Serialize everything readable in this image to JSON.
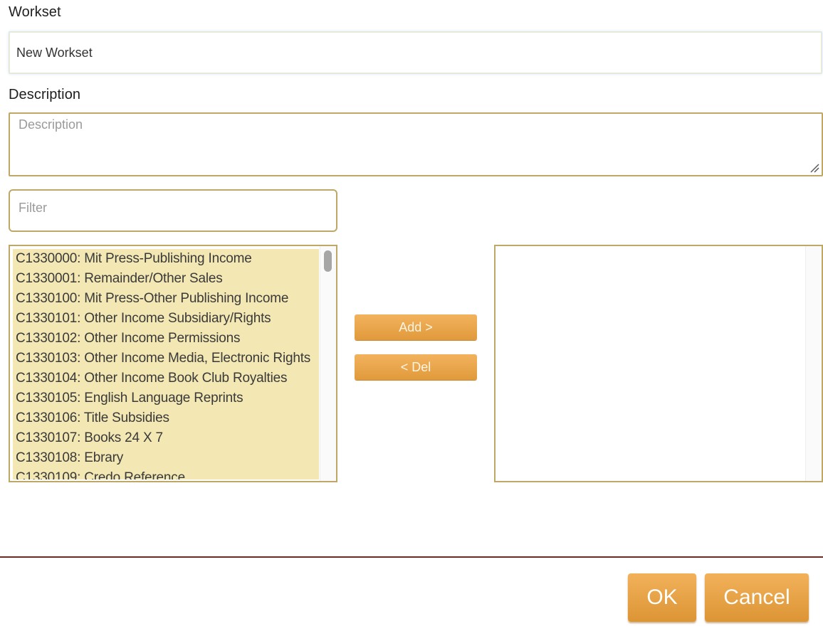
{
  "form": {
    "workset_label": "Workset",
    "workset_value": "New Workset",
    "description_label": "Description",
    "description_placeholder": "Description",
    "filter_placeholder": "Filter"
  },
  "available_list": {
    "items": [
      "C1330000: Mit Press-Publishing Income",
      "C1330001: Remainder/Other Sales",
      "C1330100: Mit Press-Other Publishing Income",
      "C1330101: Other Income Subsidiary/Rights",
      "C1330102: Other Income Permissions",
      "C1330103: Other Income Media, Electronic Rights",
      "C1330104: Other Income Book Club Royalties",
      "C1330105: English Language Reprints",
      "C1330106: Title Subsidies",
      "C1330107: Books 24 X 7",
      "C1330108: Ebrary",
      "C1330109: Credo Reference"
    ]
  },
  "selected_list": {
    "items": []
  },
  "actions": {
    "add_label": "Add >",
    "del_label": "< Del"
  },
  "footer": {
    "ok_label": "OK",
    "cancel_label": "Cancel"
  },
  "colors": {
    "accent": "#e9a347",
    "border": "#bfa865",
    "list_highlight": "#f3e7b3",
    "divider": "#6b2b22"
  }
}
